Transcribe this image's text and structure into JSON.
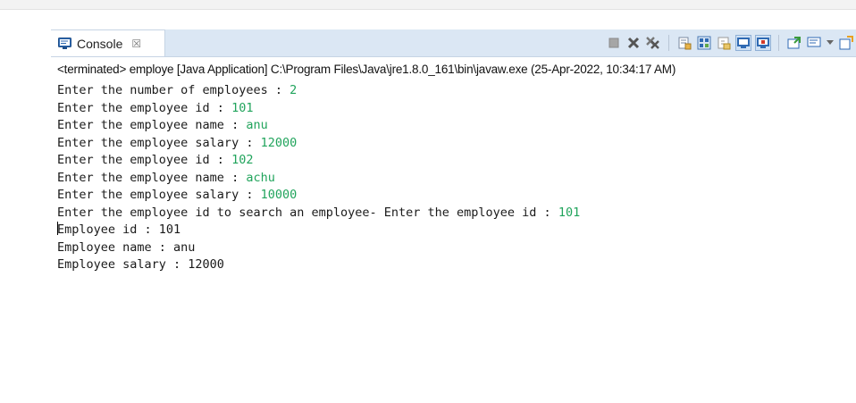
{
  "console": {
    "tab_label": "Console",
    "tab_close_symbol": "☒",
    "status_line": "<terminated> employe [Java Application] C:\\Program Files\\Java\\jre1.8.0_161\\bin\\javaw.exe (25-Apr-2022, 10:34:17 AM)",
    "input_color": "#21a45c",
    "lines": [
      {
        "text": "Enter the number of employees : ",
        "input": "2"
      },
      {
        "text": "Enter the employee id : ",
        "input": "101"
      },
      {
        "text": "Enter the employee name : ",
        "input": "anu"
      },
      {
        "text": "Enter the employee salary : ",
        "input": "12000"
      },
      {
        "text": "Enter the employee id : ",
        "input": "102"
      },
      {
        "text": "Enter the employee name : ",
        "input": "achu"
      },
      {
        "text": "Enter the employee salary : ",
        "input": "10000"
      },
      {
        "text": "Enter the employee id to search an employee- Enter the employee id : ",
        "input": "101"
      },
      {
        "text": "Employee id : 101",
        "input": ""
      },
      {
        "text": "Employee name : anu",
        "input": ""
      },
      {
        "text": "Employee salary : 12000",
        "input": ""
      }
    ]
  },
  "toolbar": {
    "icons": [
      "terminate-icon",
      "remove-launch-icon",
      "remove-all-terminated-icon",
      "scroll-lock-icon",
      "word-wrap-icon",
      "show-console-output-icon",
      "show-console-error-icon",
      "pin-console-icon",
      "display-console-icon",
      "open-console-icon"
    ]
  }
}
